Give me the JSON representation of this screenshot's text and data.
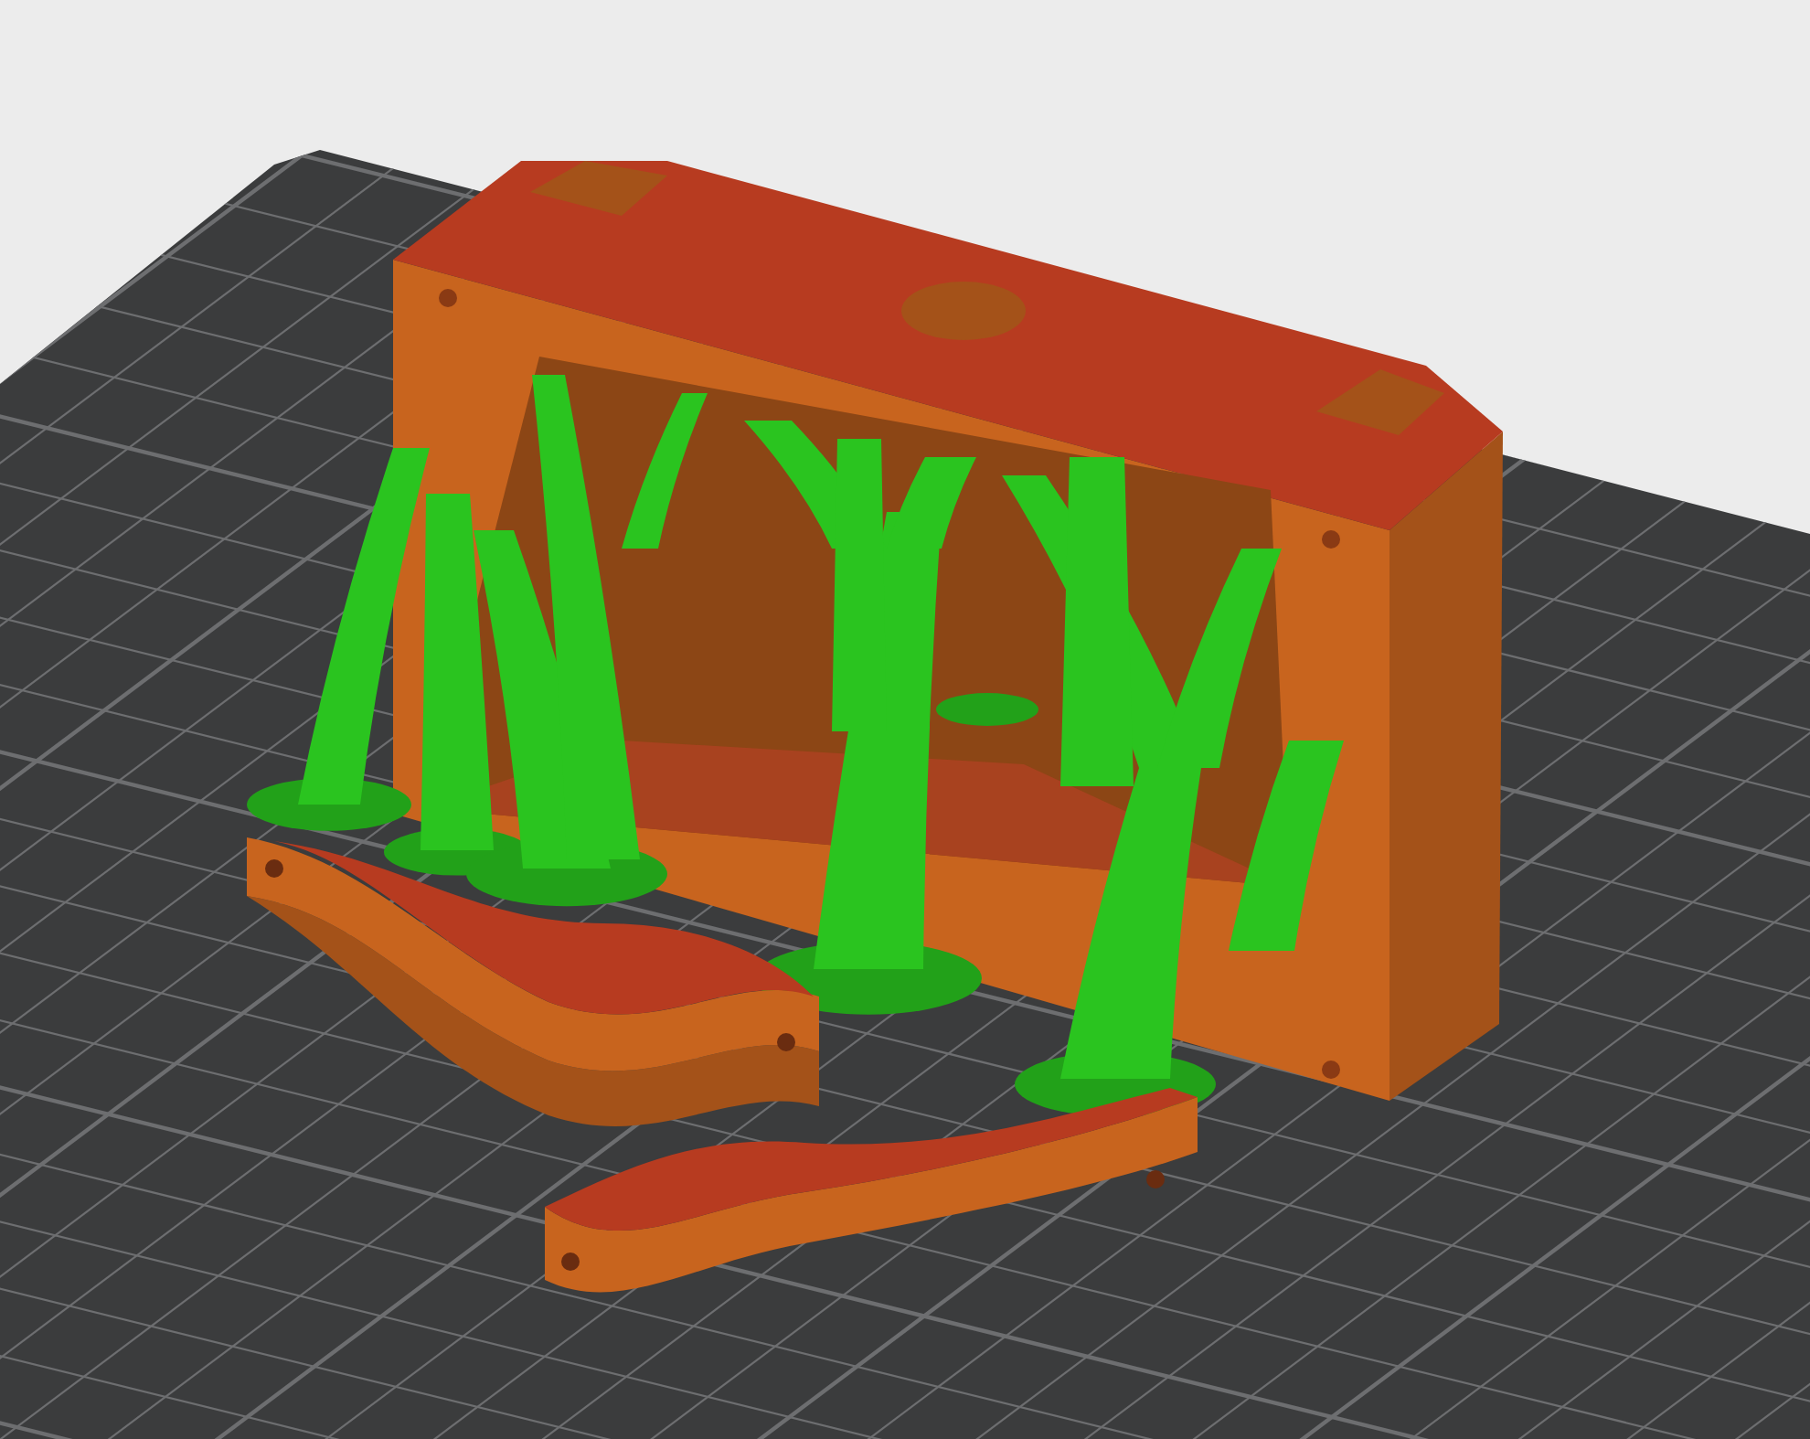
{
  "viewport": {
    "plate": {
      "kind": "grid"
    },
    "objects": [
      {
        "kind": "housing",
        "color": "#c8641e"
      },
      {
        "kind": "supports",
        "color": "#2ac41f"
      },
      {
        "kind": "bracket",
        "color": "#c8641e"
      },
      {
        "kind": "bracket2",
        "color": "#c8641e"
      }
    ]
  }
}
